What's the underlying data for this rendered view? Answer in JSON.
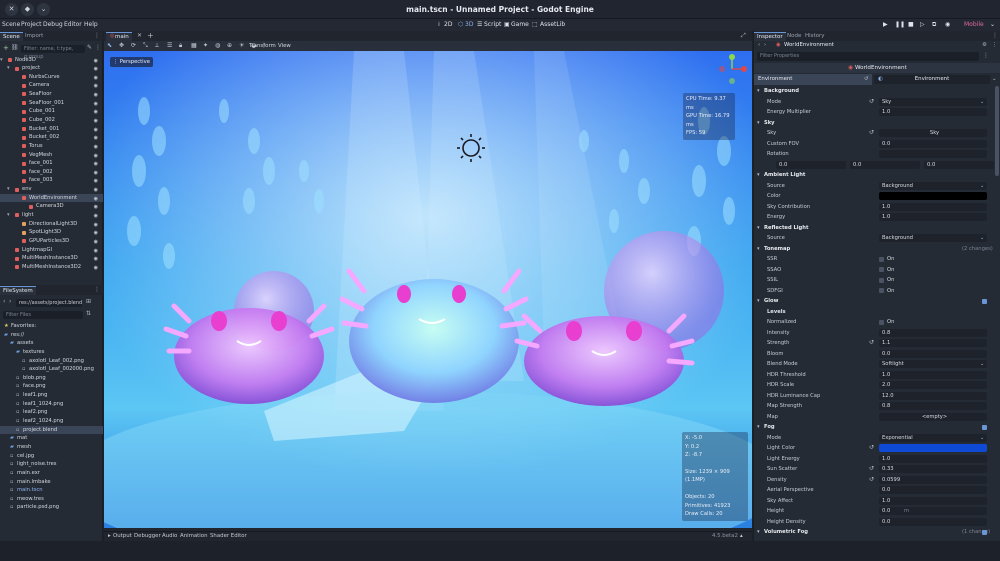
{
  "window": {
    "title": "main.tscn - Unnamed Project - Godot Engine"
  },
  "menubar": {
    "menus": [
      "Scene",
      "Project",
      "Debug",
      "Editor",
      "Help"
    ],
    "modes": [
      "2D",
      "3D",
      "Script",
      "Game",
      "AssetLib"
    ],
    "renderer": "Mobile"
  },
  "scene_dock": {
    "tabs": [
      "Scene",
      "Import"
    ],
    "filter_placeholder": "Filter: name, t:type, g:group",
    "nodes": [
      {
        "label": "Node3D",
        "depth": 0,
        "color": "#e05e5e"
      },
      {
        "label": "project",
        "depth": 1,
        "color": "#e05e5e"
      },
      {
        "label": "NurbsCurve",
        "depth": 2,
        "color": "#e05e5e"
      },
      {
        "label": "Camera",
        "depth": 2,
        "color": "#e05e5e"
      },
      {
        "label": "SeaFloor",
        "depth": 2,
        "color": "#e05e5e"
      },
      {
        "label": "SeaFloor_001",
        "depth": 2,
        "color": "#e05e5e"
      },
      {
        "label": "Cube_001",
        "depth": 2,
        "color": "#e05e5e"
      },
      {
        "label": "Cube_002",
        "depth": 2,
        "color": "#e05e5e"
      },
      {
        "label": "Bucket_001",
        "depth": 2,
        "color": "#e05e5e"
      },
      {
        "label": "Bucket_002",
        "depth": 2,
        "color": "#e05e5e"
      },
      {
        "label": "Torus",
        "depth": 2,
        "color": "#e05e5e"
      },
      {
        "label": "VegMesh",
        "depth": 2,
        "color": "#e05e5e"
      },
      {
        "label": "face_001",
        "depth": 2,
        "color": "#e05e5e"
      },
      {
        "label": "face_002",
        "depth": 2,
        "color": "#e05e5e"
      },
      {
        "label": "face_003",
        "depth": 2,
        "color": "#e05e5e"
      },
      {
        "label": "env",
        "depth": 1,
        "color": "#e05e5e"
      },
      {
        "label": "WorldEnvironment",
        "depth": 2,
        "color": "#e05e5e",
        "selected": true
      },
      {
        "label": "Camera3D",
        "depth": 3,
        "color": "#e05e5e"
      },
      {
        "label": "light",
        "depth": 1,
        "color": "#e05e5e"
      },
      {
        "label": "DirectionalLight3D",
        "depth": 2,
        "color": "#e0a05e"
      },
      {
        "label": "SpotLight3D",
        "depth": 2,
        "color": "#e0a05e"
      },
      {
        "label": "GPUParticles3D",
        "depth": 2,
        "color": "#e05e5e"
      },
      {
        "label": "LightmapGI",
        "depth": 1,
        "color": "#e05e5e"
      },
      {
        "label": "MultiMeshInstance3D",
        "depth": 1,
        "color": "#e05e5e"
      },
      {
        "label": "MultiMeshInstance3D2",
        "depth": 1,
        "color": "#e05e5e"
      }
    ]
  },
  "filesystem_dock": {
    "tab": "FileSystem",
    "path": "res://assets/project.blend",
    "filter_placeholder": "Filter Files",
    "items": [
      {
        "label": "Favorites:",
        "depth": 0,
        "kind": "fav"
      },
      {
        "label": "res://",
        "depth": 0,
        "kind": "folder"
      },
      {
        "label": "assets",
        "depth": 1,
        "kind": "folder"
      },
      {
        "label": "textures",
        "depth": 2,
        "kind": "folder"
      },
      {
        "label": "axolotl_Leaf_002.png",
        "depth": 3,
        "kind": "file"
      },
      {
        "label": "axolotl_Leaf_002000.png",
        "depth": 3,
        "kind": "file"
      },
      {
        "label": "blob.png",
        "depth": 2,
        "kind": "file"
      },
      {
        "label": "face.png",
        "depth": 2,
        "kind": "file"
      },
      {
        "label": "leaf1.png",
        "depth": 2,
        "kind": "file"
      },
      {
        "label": "leaf1_1024.png",
        "depth": 2,
        "kind": "file"
      },
      {
        "label": "leaf2.png",
        "depth": 2,
        "kind": "file"
      },
      {
        "label": "leaf2_1024.png",
        "depth": 2,
        "kind": "file"
      },
      {
        "label": "project.blend",
        "depth": 2,
        "kind": "file",
        "selected": true
      },
      {
        "label": "mat",
        "depth": 1,
        "kind": "folder"
      },
      {
        "label": "mesh",
        "depth": 1,
        "kind": "folder"
      },
      {
        "label": "cel.jpg",
        "depth": 1,
        "kind": "file"
      },
      {
        "label": "light_noise.tres",
        "depth": 1,
        "kind": "file"
      },
      {
        "label": "main.exr",
        "depth": 1,
        "kind": "file"
      },
      {
        "label": "main.lmbake",
        "depth": 1,
        "kind": "file"
      },
      {
        "label": "main.tscn",
        "depth": 1,
        "kind": "file",
        "accent": true
      },
      {
        "label": "meow.tres",
        "depth": 1,
        "kind": "file"
      },
      {
        "label": "particle.psd.png",
        "depth": 1,
        "kind": "file"
      }
    ]
  },
  "editor": {
    "tab": "main",
    "toolbar_menus": [
      "Transform",
      "View"
    ],
    "perspective_label": "Perspective",
    "perf": [
      "CPU Time: 9.37 ms",
      "GPU Time: 16.79 ms",
      "FPS: 59"
    ],
    "coords": [
      "X: -5.0",
      "Y: 0.2",
      "Z: -8.7"
    ],
    "size": "Size: 1239 × 909 (1.1MP)",
    "objects": [
      "Objects: 20",
      "Primitives: 41923",
      "Draw Calls: 20"
    ]
  },
  "bottom_panel": {
    "tabs": [
      "Output",
      "Debugger",
      "Audio",
      "Animation",
      "Shader Editor"
    ],
    "version": "4.5.beta2"
  },
  "inspector": {
    "tabs": [
      "Inspector",
      "Node",
      "History"
    ],
    "object": "WorldEnvironment",
    "filter_placeholder": "Filter Properties",
    "class_title": "WorldEnvironment",
    "env_label": "Environment",
    "env_value": "Environment",
    "rows": [
      {
        "type": "section",
        "label": "Background"
      },
      {
        "type": "prop",
        "label": "Mode",
        "value": "Sky",
        "dropdown": true,
        "revert": true
      },
      {
        "type": "prop",
        "label": "Energy Multiplier",
        "value": "1.0"
      },
      {
        "type": "section",
        "label": "Sky"
      },
      {
        "type": "prop",
        "label": "Sky",
        "value": "Sky",
        "revert": true,
        "center": true
      },
      {
        "type": "prop",
        "label": "Custom FOV",
        "value": "0.0"
      },
      {
        "type": "prop",
        "label": "Rotation",
        "value": ""
      },
      {
        "type": "vec3",
        "label": "",
        "values": [
          "0.0",
          "0.0",
          "0.0"
        ]
      },
      {
        "type": "section",
        "label": "Ambient Light"
      },
      {
        "type": "prop",
        "label": "Source",
        "value": "Background",
        "dropdown": true
      },
      {
        "type": "color",
        "label": "Color",
        "value": "#000000"
      },
      {
        "type": "prop",
        "label": "Sky Contribution",
        "value": "1.0"
      },
      {
        "type": "prop",
        "label": "Energy",
        "value": "1.0"
      },
      {
        "type": "section",
        "label": "Reflected Light"
      },
      {
        "type": "prop",
        "label": "Source",
        "value": "Background",
        "dropdown": true
      },
      {
        "type": "section",
        "label": "Tonemap",
        "note": "(2 changes)"
      },
      {
        "type": "check",
        "label": "SSR",
        "value": "On"
      },
      {
        "type": "check",
        "label": "SSAO",
        "value": "On"
      },
      {
        "type": "check",
        "label": "SSIL",
        "value": "On"
      },
      {
        "type": "check",
        "label": "SDFGI",
        "value": "On"
      },
      {
        "type": "section",
        "label": "Glow",
        "checked": true
      },
      {
        "type": "sub",
        "label": "Levels"
      },
      {
        "type": "check",
        "label": "Normalized",
        "value": "On"
      },
      {
        "type": "prop",
        "label": "Intensity",
        "value": "0.8"
      },
      {
        "type": "prop",
        "label": "Strength",
        "value": "1.1",
        "revert": true
      },
      {
        "type": "prop",
        "label": "Bloom",
        "value": "0.0"
      },
      {
        "type": "prop",
        "label": "Blend Mode",
        "value": "Softlight",
        "dropdown": true
      },
      {
        "type": "prop",
        "label": "HDR Threshold",
        "value": "1.0"
      },
      {
        "type": "prop",
        "label": "HDR Scale",
        "value": "2.0"
      },
      {
        "type": "prop",
        "label": "HDR Luminance Cap",
        "value": "12.0"
      },
      {
        "type": "prop",
        "label": "Map Strength",
        "value": "0.8"
      },
      {
        "type": "prop",
        "label": "Map",
        "value": "<empty>",
        "center": true
      },
      {
        "type": "section",
        "label": "Fog",
        "checked": true
      },
      {
        "type": "prop",
        "label": "Mode",
        "value": "Exponential",
        "dropdown": true
      },
      {
        "type": "color",
        "label": "Light Color",
        "value": "#0f4ad4",
        "revert": true
      },
      {
        "type": "prop",
        "label": "Light Energy",
        "value": "1.0"
      },
      {
        "type": "prop",
        "label": "Sun Scatter",
        "value": "0.33",
        "revert": true
      },
      {
        "type": "prop",
        "label": "Density",
        "value": "0.0599",
        "revert": true
      },
      {
        "type": "prop",
        "label": "Aerial Perspective",
        "value": "0.0"
      },
      {
        "type": "prop",
        "label": "Sky Affect",
        "value": "1.0"
      },
      {
        "type": "prop",
        "label": "Height",
        "value": "0.0",
        "unit": "m"
      },
      {
        "type": "prop",
        "label": "Height Density",
        "value": "0.0"
      },
      {
        "type": "section",
        "label": "Volumetric Fog",
        "note": "(1 change)",
        "checked": true
      }
    ]
  },
  "colors": {
    "accent": "#6a96d8",
    "selected_row": "#3a4557",
    "fog_light_color": "#0f4ad4"
  }
}
